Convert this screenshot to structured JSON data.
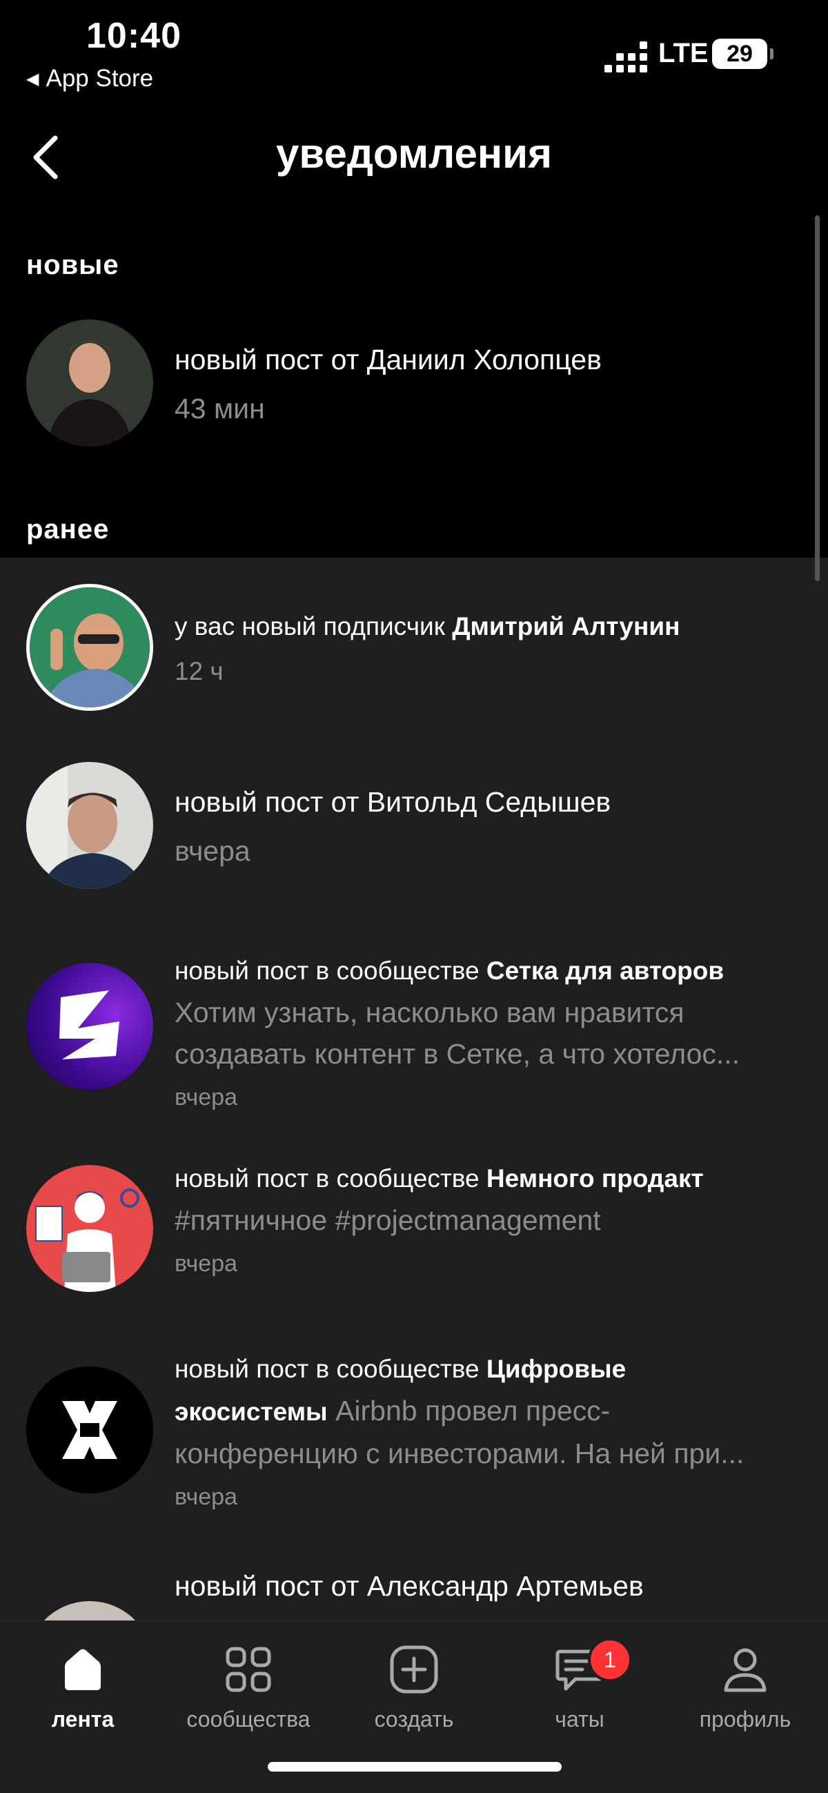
{
  "status_bar": {
    "time": "10:40",
    "back_app": "App Store",
    "network": "LTE",
    "battery": "29"
  },
  "header": {
    "title": "уведомления",
    "back_icon": "chevron-left-icon"
  },
  "sections": {
    "new_label": "новые",
    "earlier_label": "ранее"
  },
  "new_items": [
    {
      "prefix": "новый пост от Даниил Холопцев",
      "time": "43 мин"
    }
  ],
  "earlier_items": [
    {
      "prefix": "у вас новый подписчик ",
      "bold": "Дмитрий Алтунин",
      "time": "12 ч"
    },
    {
      "prefix": "новый пост от Витольд Седышев",
      "time": "вчера"
    },
    {
      "prefix": "новый пост в сообществе ",
      "bold": "Сетка для авторов",
      "snippet1": "Хотим узнать, насколько вам нравится",
      "snippet2": "создавать контент в Сетке, а что хотелос...",
      "time": "вчера"
    },
    {
      "prefix": "новый пост в сообществе ",
      "bold": "Немного продакт",
      "snippet1": "#пятничное #projectmanagement",
      "time": "вчера"
    },
    {
      "prefix": "новый пост в сообществе ",
      "bold1": "Цифровые",
      "bold2": "экосистемы",
      "snippet_inline": " Airbnb провел пресс-",
      "snippet2": "конференцию с инвесторами. На ней при...",
      "time": "вчера"
    },
    {
      "prefix": "новый пост от Александр Артемьев"
    }
  ],
  "tab_bar": {
    "tabs": [
      {
        "label": "лента",
        "icon": "home-icon"
      },
      {
        "label": "сообщества",
        "icon": "grid-icon"
      },
      {
        "label": "создать",
        "icon": "plus-square-icon"
      },
      {
        "label": "чаты",
        "icon": "chat-icon",
        "badge": "1"
      },
      {
        "label": "профиль",
        "icon": "profile-icon"
      }
    ]
  },
  "colors": {
    "background": "#000000",
    "earlier_background": "#1f1f1f",
    "secondary_text": "#8d8d8d",
    "badge": "#ff3333"
  }
}
